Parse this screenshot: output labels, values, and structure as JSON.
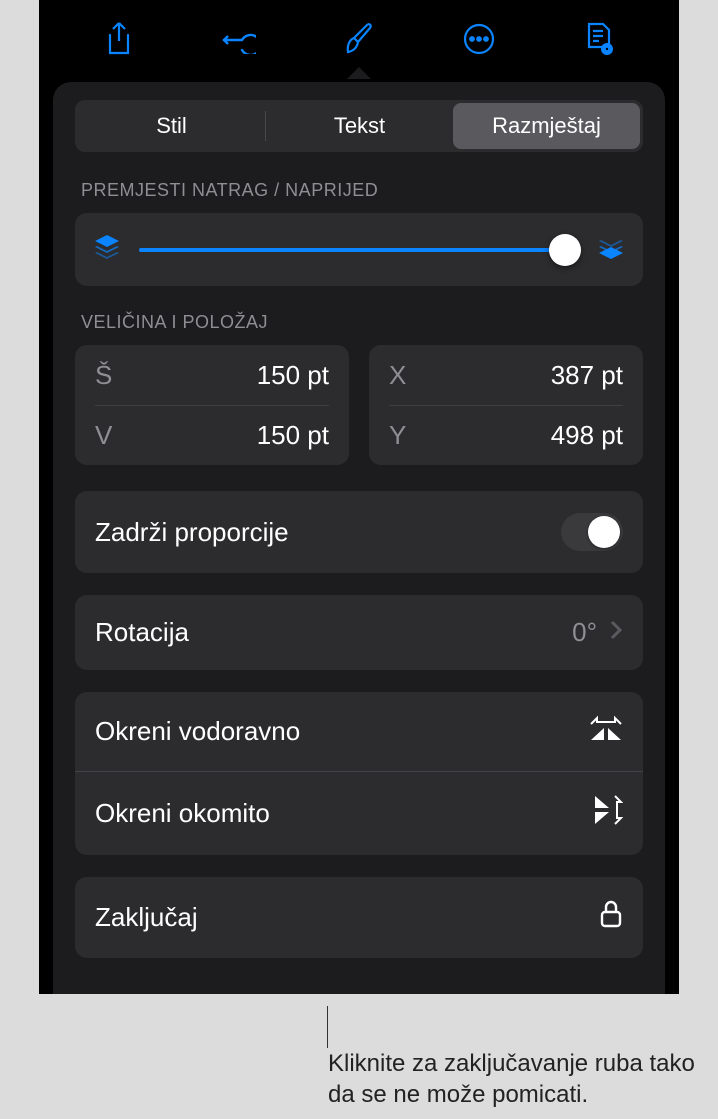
{
  "toolbar": {
    "share_icon": "share-icon",
    "undo_icon": "undo-icon",
    "format_icon": "brush-icon",
    "more_icon": "more-icon",
    "document_icon": "document-view-icon"
  },
  "tabs": {
    "style": "Stil",
    "text": "Tekst",
    "arrange": "Razmještaj"
  },
  "move": {
    "header": "Premjesti natrag / naprijed"
  },
  "size_pos": {
    "header": "Veličina i položaj",
    "w_label": "Š",
    "w_value": "150 pt",
    "h_label": "V",
    "h_value": "150 pt",
    "x_label": "X",
    "x_value": "387 pt",
    "y_label": "Y",
    "y_value": "498 pt"
  },
  "constrain": {
    "label": "Zadrži proporcije"
  },
  "rotation": {
    "label": "Rotacija",
    "value": "0°"
  },
  "flip": {
    "h_label": "Okreni vodoravno",
    "v_label": "Okreni okomito"
  },
  "lock": {
    "label": "Zaključaj"
  },
  "callout": {
    "text": "Kliknite za zaključavanje ruba tako da se ne može pomicati."
  }
}
